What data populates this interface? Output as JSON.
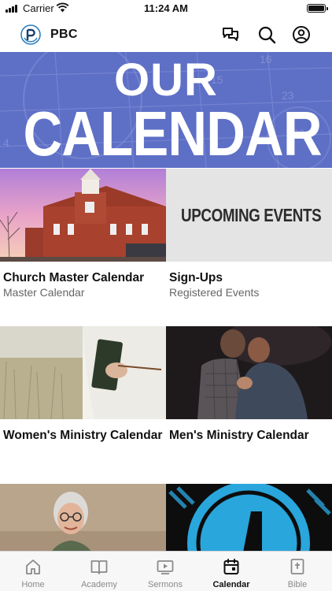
{
  "status_bar": {
    "carrier": "Carrier",
    "time": "11:24 AM"
  },
  "header": {
    "app_title": "PBC",
    "icons": [
      "logo-icon",
      "chat-icon",
      "search-icon",
      "profile-icon"
    ]
  },
  "banner": {
    "line1": "OUR",
    "line2": "CALENDAR",
    "background_color": "#5e6fc6"
  },
  "cards": [
    {
      "title": "Church Master Calendar",
      "subtitle": "Master Calendar"
    },
    {
      "title": "Sign-Ups",
      "subtitle": "Registered Events",
      "image_text": "UPCOMING EVENTS"
    },
    {
      "title": "Women's Ministry Calendar",
      "subtitle": ""
    },
    {
      "title": "Men's Ministry Calendar",
      "subtitle": ""
    },
    {
      "title": "",
      "subtitle": ""
    },
    {
      "title": "",
      "subtitle": ""
    }
  ],
  "tab_bar": {
    "tabs": [
      {
        "label": "Home",
        "icon": "home-icon",
        "active": false
      },
      {
        "label": "Academy",
        "icon": "book-icon",
        "active": false
      },
      {
        "label": "Sermons",
        "icon": "video-icon",
        "active": false
      },
      {
        "label": "Calendar",
        "icon": "calendar-icon",
        "active": true
      },
      {
        "label": "Bible",
        "icon": "bible-icon",
        "active": false
      }
    ]
  },
  "colors": {
    "accent": "#111111",
    "inactive_tab": "#8a8a8a",
    "banner_blue": "#5e6fc6"
  }
}
